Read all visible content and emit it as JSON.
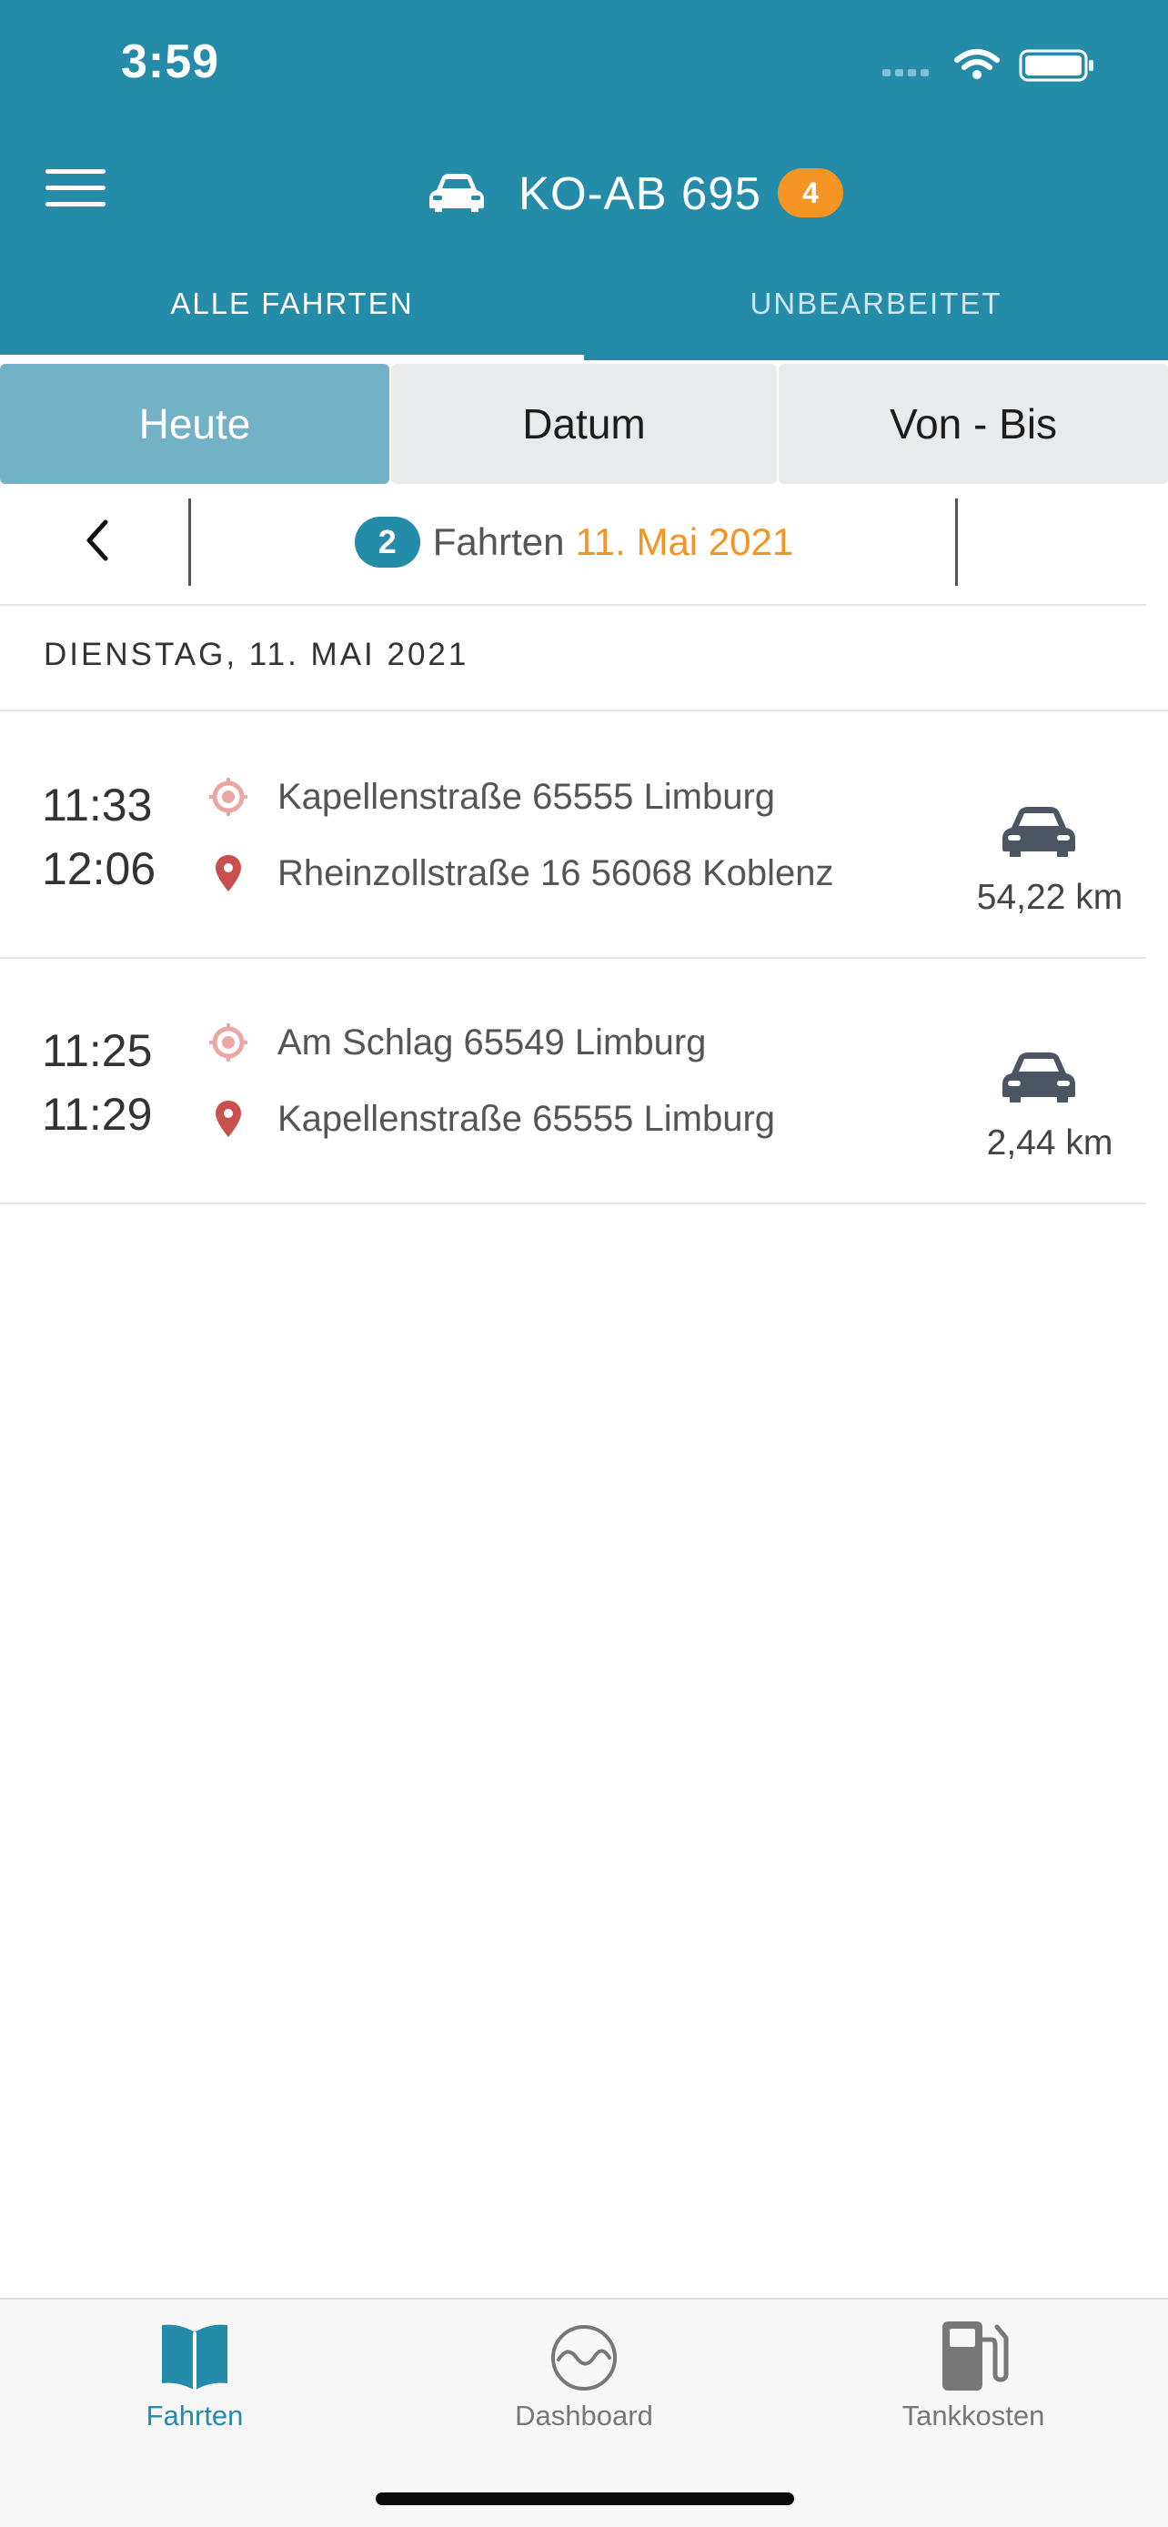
{
  "status": {
    "time": "3:59"
  },
  "header": {
    "title": "KO-AB 695",
    "badge": "4"
  },
  "tabs": {
    "all": "ALLE FAHRTEN",
    "open": "UNBEARBEITET"
  },
  "segments": {
    "today": "Heute",
    "date": "Datum",
    "range": "Von - Bis"
  },
  "date_nav": {
    "count": "2",
    "label": "Fahrten",
    "date": "11. Mai 2021"
  },
  "day_header": "DIENSTAG, 11. MAI 2021",
  "trips": [
    {
      "start_time": "11:33",
      "end_time": "12:06",
      "from": "Kapellenstraße 65555 Limburg",
      "to": "Rheinzollstraße 16 56068 Koblenz",
      "distance": "54,22 km"
    },
    {
      "start_time": "11:25",
      "end_time": "11:29",
      "from": "Am Schlag 65549 Limburg",
      "to": "Kapellenstraße 65555 Limburg",
      "distance": "2,44 km"
    }
  ],
  "tabbar": {
    "trips": "Fahrten",
    "dashboard": "Dashboard",
    "fuel": "Tankkosten"
  },
  "colors": {
    "primary": "#248ba8",
    "accent": "#f39423",
    "segment_active": "#73b2c6",
    "pin": "#c8504f"
  },
  "icons": [
    "menu-icon",
    "car-icon",
    "chevron-left-icon",
    "start-marker-icon",
    "location-pin-icon",
    "book-icon",
    "dashboard-icon",
    "fuel-pump-icon",
    "wifi-icon",
    "battery-icon",
    "signal-icon"
  ]
}
